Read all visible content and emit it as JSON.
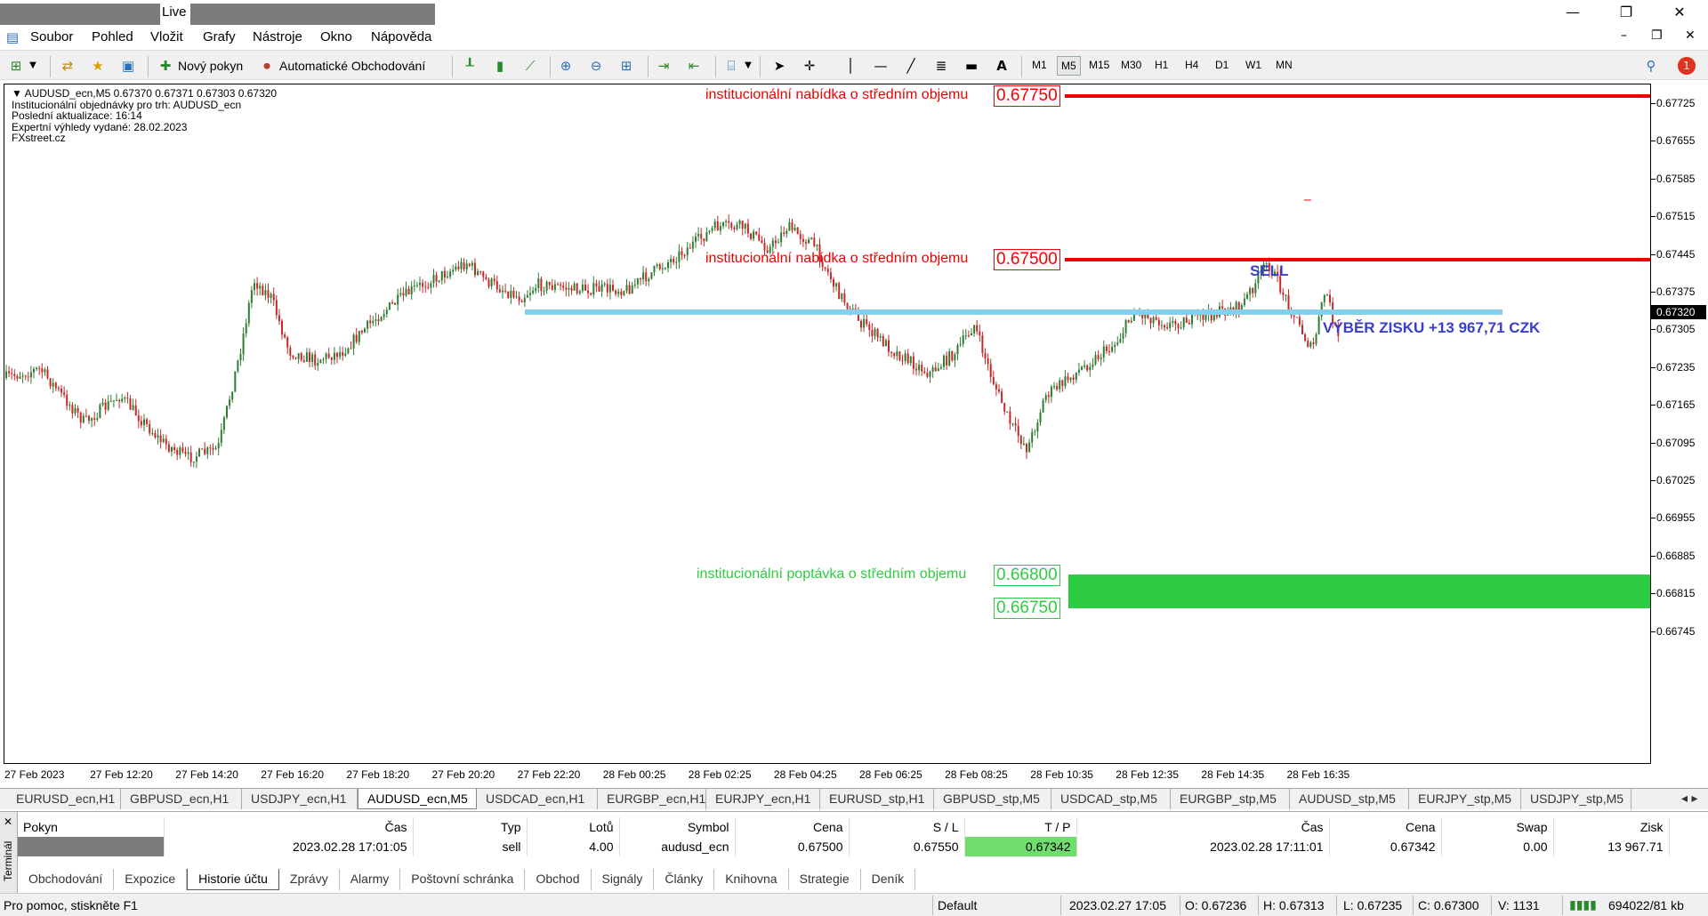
{
  "window": {
    "title": "Live -",
    "controls": {
      "minimize": "—",
      "maximize": "❐",
      "close": "✕"
    }
  },
  "menu": {
    "items": [
      "Soubor",
      "Pohled",
      "Vložit",
      "Grafy",
      "Nástroje",
      "Okno",
      "Nápověda"
    ]
  },
  "toolbar": {
    "new_order_label": "Nový pokyn",
    "auto_trading_label": "Automatické Obchodování",
    "text_tool_label": "A",
    "timeframes": [
      "M1",
      "M5",
      "M15",
      "M30",
      "H1",
      "H4",
      "D1",
      "W1",
      "MN"
    ],
    "active_timeframe": "M5",
    "notification_count": "1"
  },
  "chart": {
    "info_lines": [
      "AUDUSD_ecn,M5  0.67370 0.67371 0.67303 0.67320",
      "Institucionální objednávky pro trh: AUDUSD_ecn",
      "Poslední aktualizace: 16:14",
      "Expertní výhledy vydané: 28.02.2023",
      "FXstreet.cz"
    ],
    "levels": [
      {
        "label": "institucionální nabídka o středním objemu",
        "price": "0.67750",
        "color": "#f20000"
      },
      {
        "label": "institucionální nabídka o středním objemu",
        "price": "0.67500",
        "color": "#f20000"
      },
      {
        "label": "institucionální poptávka o středním objemu",
        "price_top": "0.66800",
        "price_bottom": "0.66750",
        "color": "#2ecc40"
      }
    ],
    "sell_label": "SELL",
    "profit_label": "VÝBĚR ZISKU +13 967,71 CZK",
    "take_profit_line_color": "#87ceeb",
    "current_price": "0.67320",
    "y_ticks": [
      "0.67725",
      "0.67655",
      "0.67585",
      "0.67515",
      "0.67445",
      "0.67375",
      "0.67305",
      "0.67235",
      "0.67165",
      "0.67095",
      "0.67025",
      "0.66955",
      "0.66885",
      "0.66815",
      "0.66745"
    ],
    "x_ticks": [
      "27 Feb 2023",
      "27 Feb 12:20",
      "27 Feb 14:20",
      "27 Feb 16:20",
      "27 Feb 18:20",
      "27 Feb 20:20",
      "27 Feb 22:20",
      "28 Feb 00:25",
      "28 Feb 02:25",
      "28 Feb 04:25",
      "28 Feb 06:25",
      "28 Feb 08:25",
      "28 Feb 10:35",
      "28 Feb 12:35",
      "28 Feb 14:35",
      "28 Feb 16:35"
    ]
  },
  "chart_tabs": [
    "EURUSD_ecn,H1",
    "GBPUSD_ecn,H1",
    "USDJPY_ecn,H1",
    "AUDUSD_ecn,M5",
    "USDCAD_ecn,H1",
    "EURGBP_ecn,H1",
    "EURJPY_ecn,H1",
    "EURUSD_stp,H1",
    "GBPUSD_stp,M5",
    "USDCAD_stp,M5",
    "EURGBP_stp,M5",
    "AUDUSD_stp,M5",
    "EURJPY_stp,M5",
    "USDJPY_stp,M5"
  ],
  "active_chart_tab": "AUDUSD_ecn,M5",
  "terminal": {
    "side_label": "Terminál",
    "columns": [
      "Pokyn",
      "Čas",
      "Typ",
      "Lotů",
      "Symbol",
      "Cena",
      "S / L",
      "T / P",
      "Čas",
      "Cena",
      "Swap",
      "Zisk"
    ],
    "rows": [
      {
        "order": "",
        "open_time": "2023.02.28 17:01:05",
        "type": "sell",
        "lots": "4.00",
        "symbol": "audusd_ecn",
        "open_price": "0.67500",
        "sl": "0.67550",
        "tp": "0.67342",
        "close_time": "2023.02.28 17:11:01",
        "close_price": "0.67342",
        "swap": "0.00",
        "profit": "13 967.71"
      }
    ],
    "tabs": [
      "Obchodování",
      "Expozice",
      "Historie účtu",
      "Zprávy",
      "Alarmy",
      "Poštovní schránka",
      "Obchod",
      "Signály",
      "Články",
      "Knihovna",
      "Strategie",
      "Deník"
    ],
    "active_tab": "Historie účtu"
  },
  "status": {
    "help": "Pro pomoc, stiskněte F1",
    "profile": "Default",
    "datetime": "2023.02.27 17:05",
    "open": "O: 0.67236",
    "high": "H: 0.67313",
    "low": "L: 0.67235",
    "close": "C: 0.67300",
    "volume": "V: 1131",
    "traffic": "694022/81 kb"
  }
}
